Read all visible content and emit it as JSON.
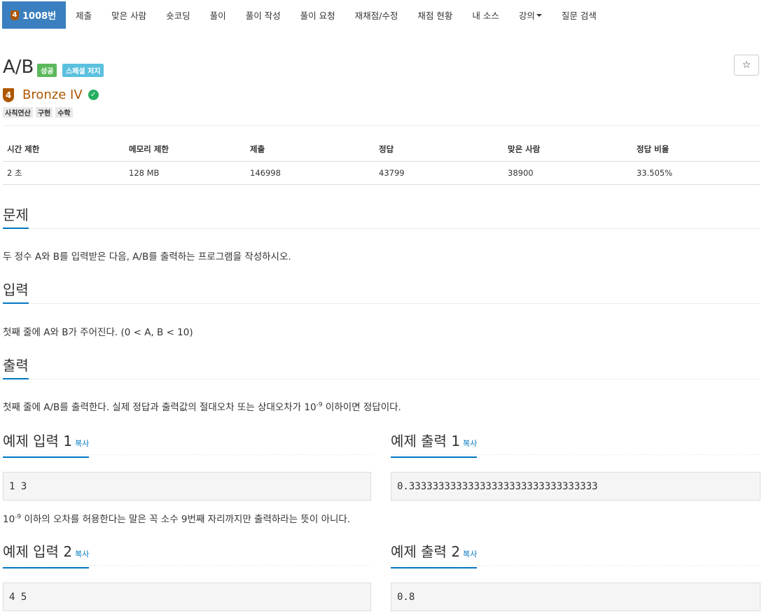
{
  "nav": {
    "active_tier": "4",
    "active_label": "1008번",
    "items": [
      "제출",
      "맞은 사람",
      "숏코딩",
      "풀이",
      "풀이 작성",
      "풀이 요청",
      "재채점/수정",
      "채점 현황",
      "내 소스",
      "강의",
      "질문 검색"
    ]
  },
  "problem": {
    "title": "A/B",
    "label_success": "성공",
    "label_info": "스페셜 저지",
    "star": "☆",
    "tier_num": "4",
    "tier_name": "Bronze IV",
    "tags": [
      "사칙연산",
      "구현",
      "수학"
    ]
  },
  "stats": {
    "headers": [
      "시간 제한",
      "메모리 제한",
      "제출",
      "정답",
      "맞은 사람",
      "정답 비율"
    ],
    "values": [
      "2 초",
      "128 MB",
      "146998",
      "43799",
      "38900",
      "33.505%"
    ]
  },
  "sections": {
    "description_title": "문제",
    "description": "두 정수 A와 B를 입력받은 다음, A/B를 출력하는 프로그램을 작성하시오.",
    "input_title": "입력",
    "input": "첫째 줄에 A와 B가 주어진다. (0 < A, B < 10)",
    "output_title": "출력",
    "output_pre": "첫째 줄에 A/B를 출력한다. 실제 정답과 출력값의 절대오차 또는 상대오차가 10",
    "output_sup": "-9",
    "output_post": " 이하이면 정답이다."
  },
  "samples": {
    "copy": "복사",
    "in1_title": "예제 입력 1",
    "out1_title": "예제 출력 1",
    "in1": "1 3",
    "out1": "0.33333333333333333333333333333333",
    "note_pre": "10",
    "note_sup": "-9",
    "note_post": " 이하의 오차를 허용한다는 말은 꼭 소수 9번째 자리까지만 출력하라는 뜻이 아니다.",
    "in2_title": "예제 입력 2",
    "out2_title": "예제 출력 2",
    "in2": "4 5",
    "out2": "0.8"
  },
  "colors": {
    "nav_active": "#3a7fbf",
    "bronze": "#ad5600",
    "success": "#5cb85c",
    "info": "#5bc0de",
    "link": "#0076c0"
  }
}
